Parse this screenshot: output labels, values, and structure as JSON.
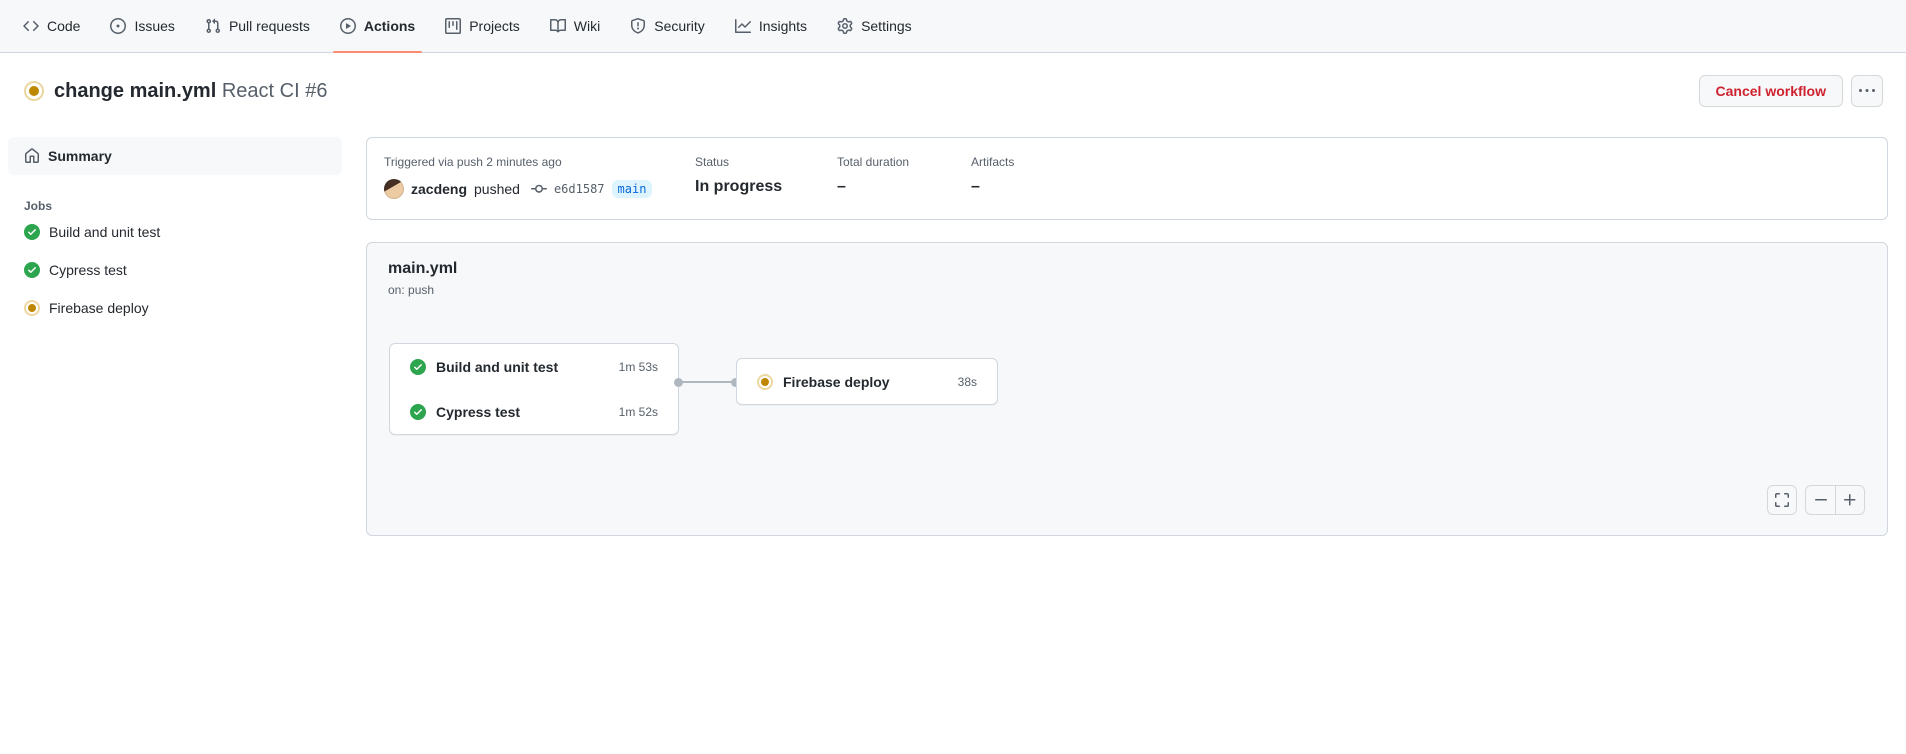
{
  "nav": {
    "items": [
      {
        "label": "Code"
      },
      {
        "label": "Issues"
      },
      {
        "label": "Pull requests"
      },
      {
        "label": "Actions"
      },
      {
        "label": "Projects"
      },
      {
        "label": "Wiki"
      },
      {
        "label": "Security"
      },
      {
        "label": "Insights"
      },
      {
        "label": "Settings"
      }
    ]
  },
  "header": {
    "title": "change main.yml",
    "subtitle": "React CI #6",
    "cancel_label": "Cancel workflow"
  },
  "sidebar": {
    "summary_label": "Summary",
    "jobs_heading": "Jobs",
    "jobs": [
      {
        "label": "Build and unit test",
        "status": "success"
      },
      {
        "label": "Cypress test",
        "status": "success"
      },
      {
        "label": "Firebase deploy",
        "status": "in_progress"
      }
    ]
  },
  "run_info": {
    "triggered": "Triggered via push 2 minutes ago",
    "actor": "zacdeng",
    "action": "pushed",
    "commit_sha": "e6d1587",
    "branch": "main",
    "status_label": "Status",
    "status_value": "In progress",
    "duration_label": "Total duration",
    "duration_value": "–",
    "artifacts_label": "Artifacts",
    "artifacts_value": "–"
  },
  "graph": {
    "file_name": "main.yml",
    "trigger": "on: push",
    "jobs": [
      {
        "label": "Build and unit test",
        "duration": "1m 53s",
        "status": "success"
      },
      {
        "label": "Cypress test",
        "duration": "1m 52s",
        "status": "success"
      },
      {
        "label": "Firebase deploy",
        "duration": "38s",
        "status": "in_progress"
      }
    ]
  },
  "colors": {
    "active_tab_underline": "#fd8c73",
    "success_green": "#2da44e",
    "in_progress_yellow": "#bf8700",
    "danger_red": "#cf222e",
    "branch_badge_bg": "#ddf4ff",
    "branch_badge_text": "#0969da"
  }
}
